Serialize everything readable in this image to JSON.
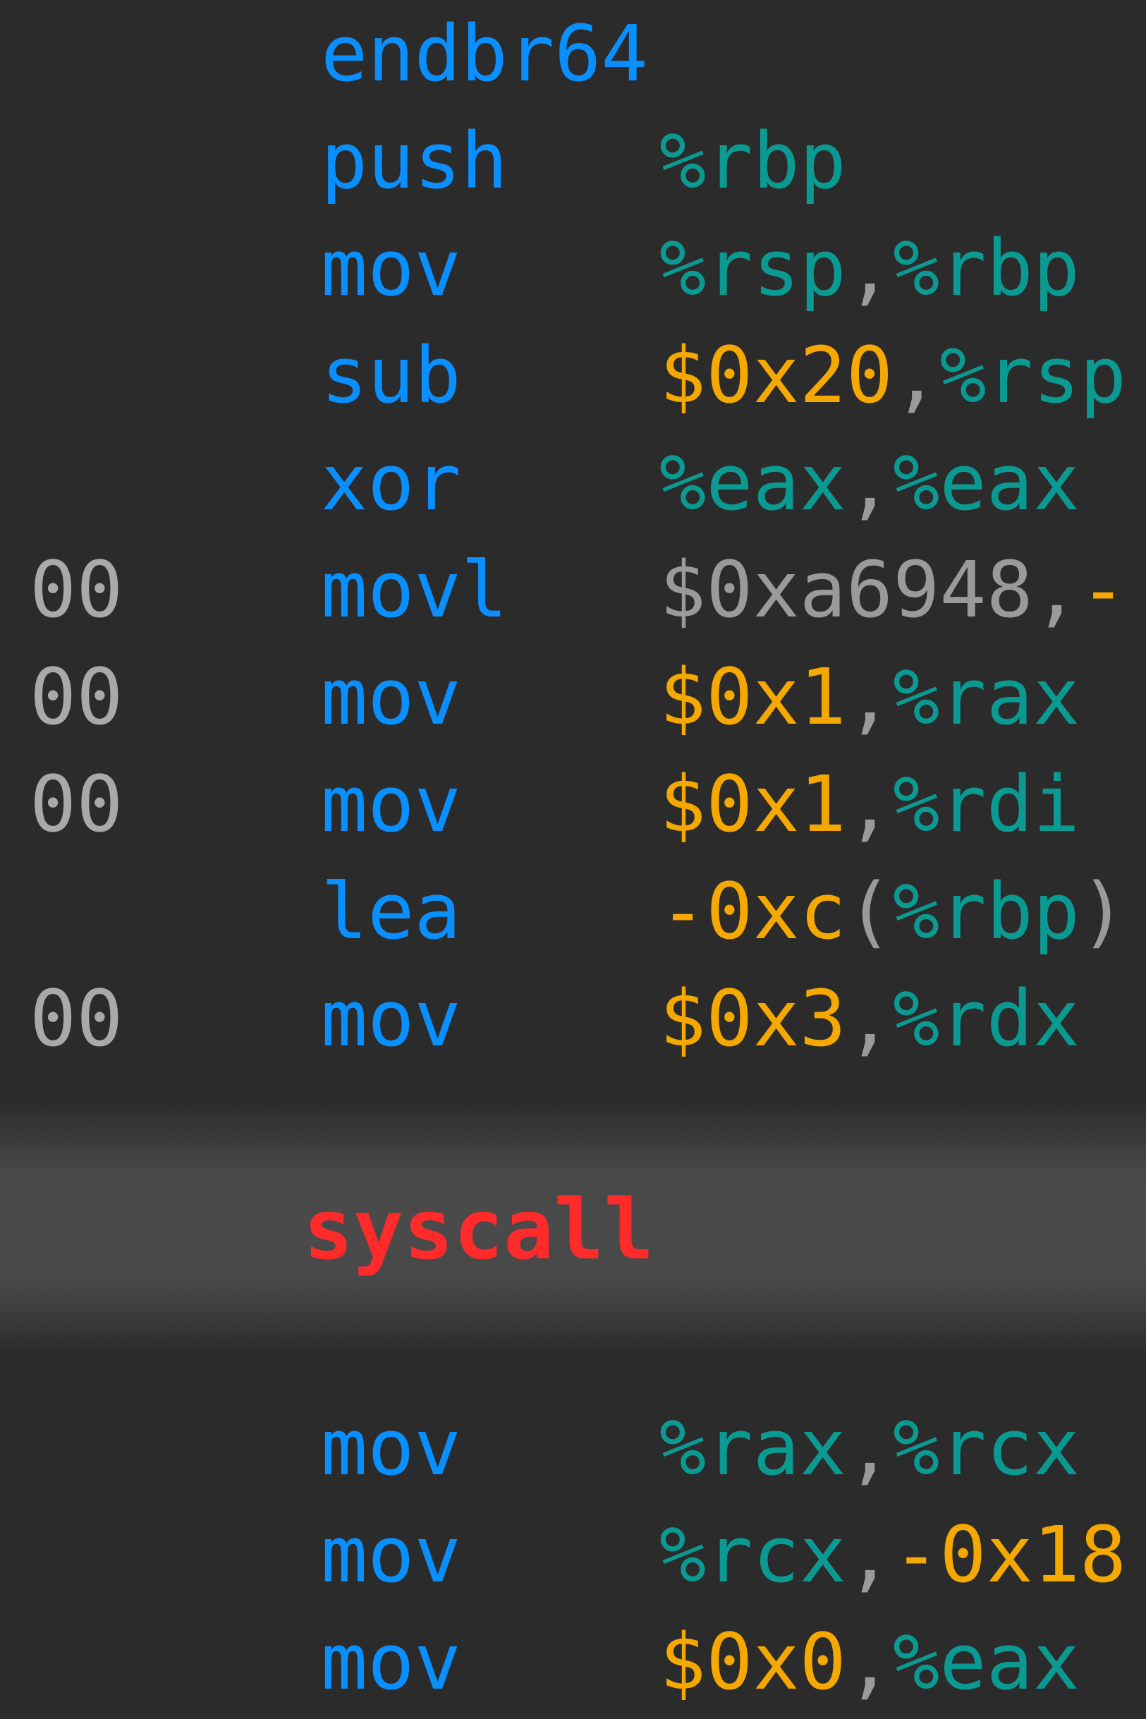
{
  "colors": {
    "background": "#2b2b2b",
    "mnemonic": "#0a8fff",
    "register": "#0b9a91",
    "immediate": "#f5a800",
    "punct": "#9a9a9a",
    "address": "#a9a9a9",
    "syscall": "#ff2a2a"
  },
  "lines": [
    {
      "addr": "",
      "mnem": "endbr64",
      "ops": []
    },
    {
      "addr": "",
      "mnem": "push",
      "ops": [
        {
          "t": "%rbp",
          "k": "register"
        }
      ]
    },
    {
      "addr": "",
      "mnem": "mov",
      "ops": [
        {
          "t": "%rsp",
          "k": "register"
        },
        {
          "t": ",",
          "k": "punct"
        },
        {
          "t": "%rbp",
          "k": "register"
        }
      ]
    },
    {
      "addr": "",
      "mnem": "sub",
      "ops": [
        {
          "t": "$0x20",
          "k": "immediate"
        },
        {
          "t": ",",
          "k": "punct"
        },
        {
          "t": "%rsp",
          "k": "register"
        }
      ]
    },
    {
      "addr": "",
      "mnem": "xor",
      "ops": [
        {
          "t": "%eax",
          "k": "register"
        },
        {
          "t": ",",
          "k": "punct"
        },
        {
          "t": "%eax",
          "k": "register"
        }
      ]
    },
    {
      "addr": "00",
      "mnem": "movl",
      "ops": [
        {
          "t": "$0xa6948,",
          "k": "punct"
        },
        {
          "t": "-",
          "k": "immediate"
        }
      ]
    },
    {
      "addr": "00",
      "mnem": "mov",
      "ops": [
        {
          "t": "$0x1",
          "k": "immediate"
        },
        {
          "t": ",",
          "k": "punct"
        },
        {
          "t": "%rax",
          "k": "register"
        }
      ]
    },
    {
      "addr": "00",
      "mnem": "mov",
      "ops": [
        {
          "t": "$0x1",
          "k": "immediate"
        },
        {
          "t": ",",
          "k": "punct"
        },
        {
          "t": "%rdi",
          "k": "register"
        }
      ]
    },
    {
      "addr": "",
      "mnem": "lea",
      "ops": [
        {
          "t": "-0xc",
          "k": "immediate"
        },
        {
          "t": "(",
          "k": "punct"
        },
        {
          "t": "%rbp",
          "k": "register"
        },
        {
          "t": ")",
          "k": "punct"
        }
      ]
    },
    {
      "addr": "00",
      "mnem": "mov",
      "ops": [
        {
          "t": "$0x3",
          "k": "immediate"
        },
        {
          "t": ",",
          "k": "punct"
        },
        {
          "t": "%rdx",
          "k": "register"
        }
      ]
    }
  ],
  "highlight": {
    "mnem": "syscall"
  },
  "lines_after": [
    {
      "addr": "",
      "mnem": "mov",
      "ops": [
        {
          "t": "%rax",
          "k": "register"
        },
        {
          "t": ",",
          "k": "punct"
        },
        {
          "t": "%rcx",
          "k": "register"
        }
      ]
    },
    {
      "addr": "",
      "mnem": "mov",
      "ops": [
        {
          "t": "%rcx",
          "k": "register"
        },
        {
          "t": ",",
          "k": "punct"
        },
        {
          "t": "-0x18",
          "k": "immediate"
        }
      ]
    },
    {
      "addr": "",
      "mnem": "mov",
      "ops": [
        {
          "t": "$0x0",
          "k": "immediate"
        },
        {
          "t": ",",
          "k": "punct"
        },
        {
          "t": "%eax",
          "k": "register"
        }
      ]
    }
  ]
}
